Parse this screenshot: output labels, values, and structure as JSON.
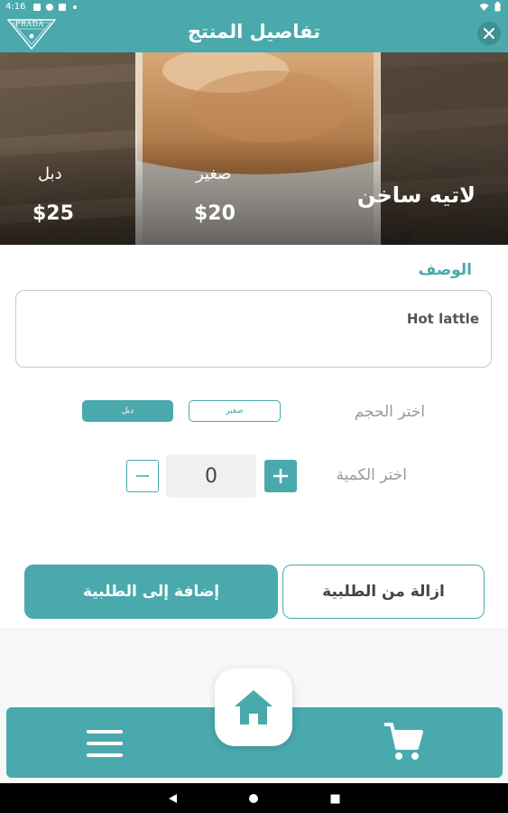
{
  "status_bar": {
    "time": "4:16"
  },
  "header": {
    "logo_text": "PRADA",
    "title": "تفاصيل المنتج"
  },
  "product": {
    "name": "لاتيه ساخن",
    "prices": [
      {
        "label": "صغير",
        "price": "$20"
      },
      {
        "label": "دبل",
        "price": "$25"
      }
    ]
  },
  "description": {
    "label": "الوصف",
    "text": "Hot lattle"
  },
  "size": {
    "label": "اختر الحجم",
    "options": [
      {
        "label": "صغير",
        "selected": false
      },
      {
        "label": "دبل",
        "selected": true
      }
    ]
  },
  "quantity": {
    "label": "اختر الكمية",
    "value": "0"
  },
  "actions": {
    "remove_label": "ازالة من الطلبية",
    "add_label": "إضافة إلى الطلبية"
  },
  "icons": {
    "close": "close-icon",
    "home": "home-icon",
    "menu": "menu-icon",
    "cart": "cart-icon",
    "plus": "plus-icon",
    "minus": "minus-icon",
    "back": "back-icon",
    "nav_home": "circle-icon",
    "recents": "square-icon"
  },
  "colors": {
    "accent": "#4aa9ad",
    "text": "#444444",
    "muted": "#9a9a9a"
  }
}
